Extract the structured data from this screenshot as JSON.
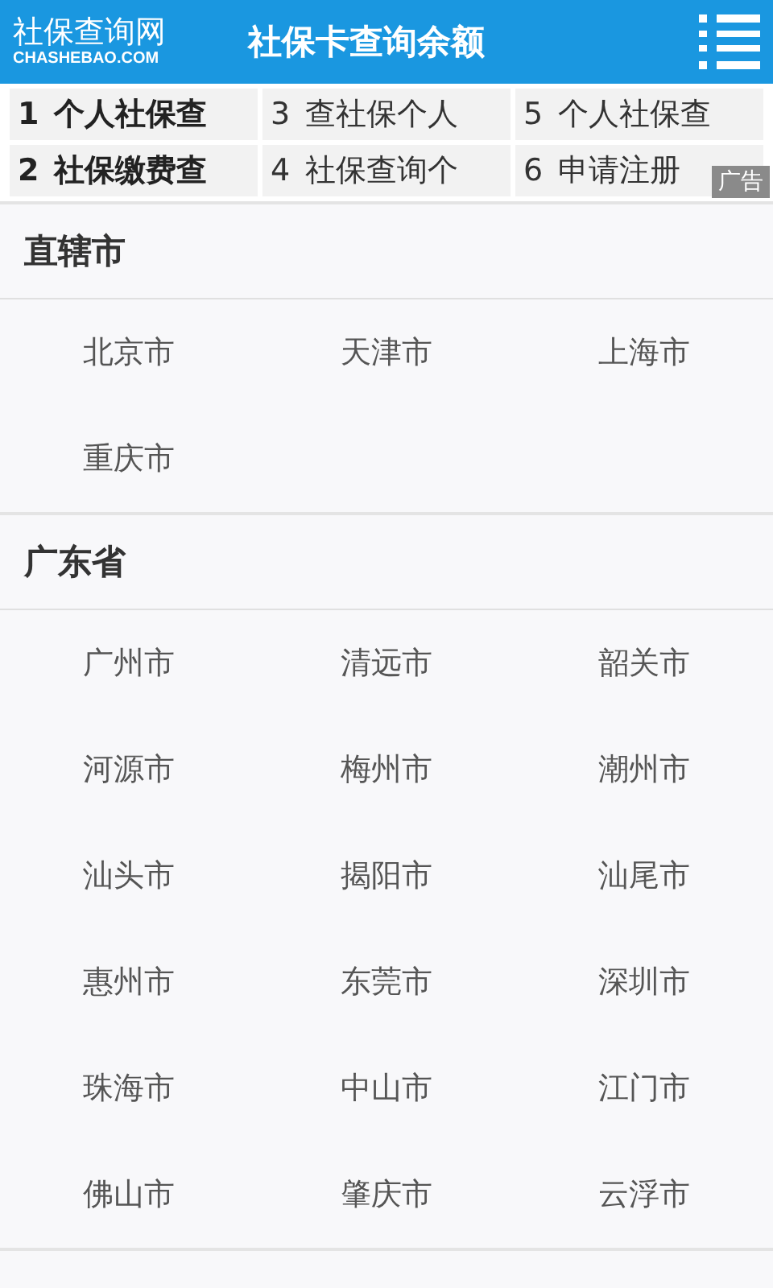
{
  "header": {
    "logo": "社保查询网",
    "logo_domain": "CHASHEBAO.COM",
    "title": "社保卡查询余额"
  },
  "ad_links": [
    {
      "number": "1",
      "label": "个人社保查",
      "bold": true
    },
    {
      "number": "2",
      "label": "社保缴费查",
      "bold": true
    },
    {
      "number": "3",
      "label": "查社保个人",
      "bold": false
    },
    {
      "number": "4",
      "label": "社保查询个",
      "bold": false
    },
    {
      "number": "5",
      "label": "个人社保查",
      "bold": false
    },
    {
      "number": "6",
      "label": "申请注册",
      "bold": false
    }
  ],
  "ad_badge": "广告",
  "regions": [
    {
      "name": "直辖市",
      "cities": [
        "北京市",
        "天津市",
        "上海市",
        "重庆市"
      ]
    },
    {
      "name": "广东省",
      "cities": [
        "广州市",
        "清远市",
        "韶关市",
        "河源市",
        "梅州市",
        "潮州市",
        "汕头市",
        "揭阳市",
        "汕尾市",
        "惠州市",
        "东莞市",
        "深圳市",
        "珠海市",
        "中山市",
        "江门市",
        "佛山市",
        "肇庆市",
        "云浮市"
      ]
    }
  ]
}
